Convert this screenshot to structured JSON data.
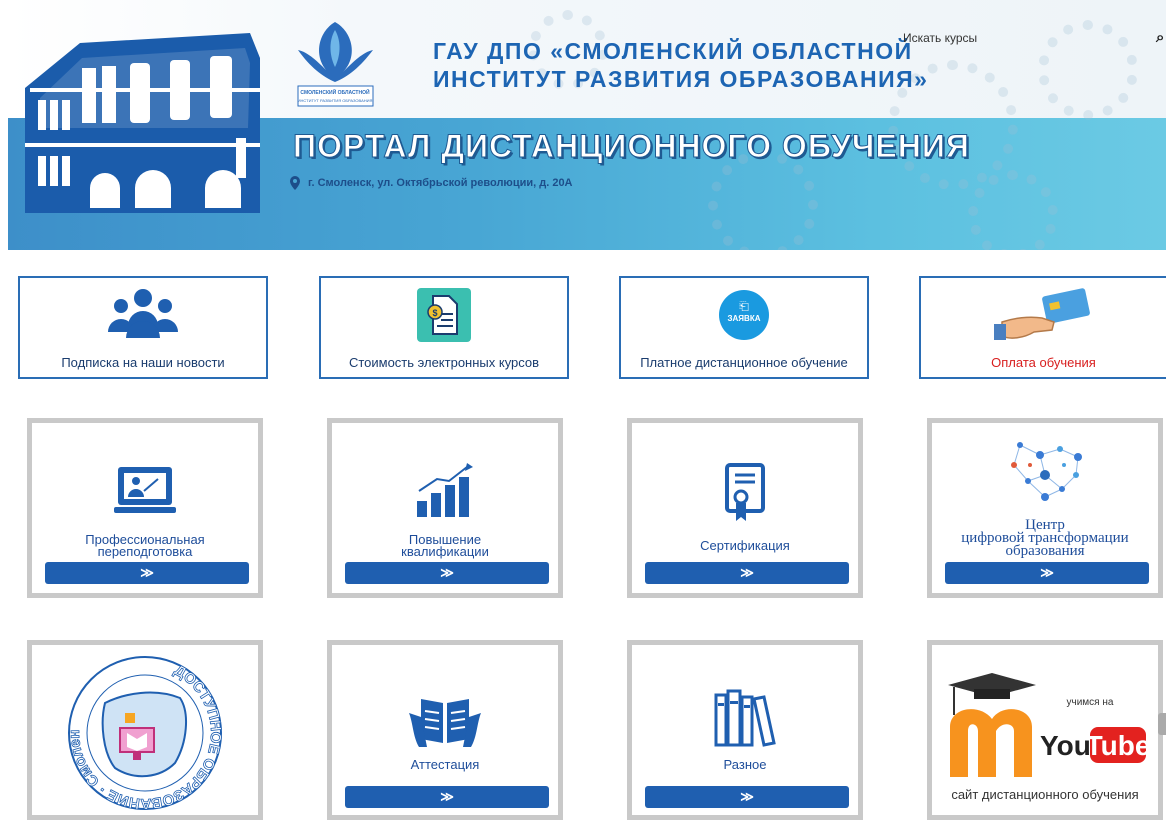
{
  "header": {
    "institute_title": "ГАУ ДПО «СМОЛЕНСКИЙ ОБЛАСТНОЙ\nИНСТИТУТ РАЗВИТИЯ ОБРАЗОВАНИЯ»",
    "emblem_text": "СМОЛЕНСКИЙ ОБЛАСТНОЙ ИНСТИТУТ РАЗВИТИЯ ОБРАЗОВАНИЯ",
    "portal_title": "ПОРТАЛ ДИСТАНЦИОННОГО ОБУЧЕНИЯ",
    "address": "г. Смоленск, ул. Октябрьской революции, д. 20А",
    "search_label": "Искать курсы"
  },
  "top_boxes": [
    {
      "label": "Подписка на наши новости",
      "icon": "people-group-icon"
    },
    {
      "label": "Стоимость электронных курсов",
      "icon": "price-document-icon"
    },
    {
      "label": "Платное дистанционное обучение",
      "icon": "application-icon",
      "icon_text": "ЗАЯВКА"
    },
    {
      "label": "Оплата обучения",
      "icon": "card-payment-icon",
      "accent": "#d81e1e"
    }
  ],
  "cards": [
    {
      "label": "Профессиональная\nпереподготовка",
      "icon": "presentation-screen-icon",
      "button": "≫"
    },
    {
      "label": "Повышение\nквалификации",
      "icon": "growth-chart-icon",
      "button": "≫"
    },
    {
      "label": "Сертификация",
      "icon": "certificate-icon",
      "button": "≫"
    },
    {
      "label": "Центр\nцифровой трансформации\nобразования",
      "icon": "network-heart-icon",
      "button": "≫"
    },
    {
      "label": "",
      "icon": "accessible-education-logo",
      "logo_text": "ДОСТУПНОЕ ОБРАЗОВАНИЕ · Смоленская область"
    },
    {
      "label": "Аттестация",
      "icon": "open-book-icon",
      "button": "≫"
    },
    {
      "label": "Разное",
      "icon": "books-icon",
      "button": "≫"
    },
    {
      "label": "сайт дистанционного обучения",
      "icon": "moodle-youtube-logo",
      "logo_text_top": "учимся на",
      "logo_you": "You",
      "logo_tube": "Tube"
    }
  ],
  "colors": {
    "brand_blue": "#1f5fb0",
    "accent_red": "#d81e1e",
    "band": "#48a6d4"
  }
}
